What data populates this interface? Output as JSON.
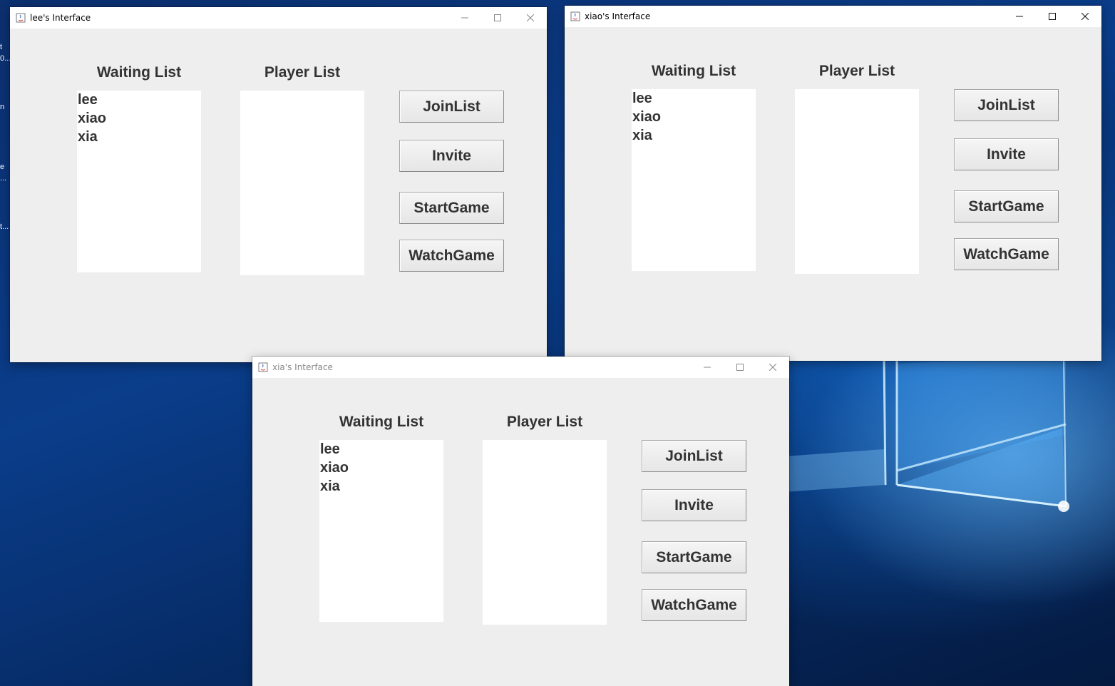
{
  "desktop": {
    "side_labels": [
      "t",
      "0...",
      "n",
      "e",
      "...",
      "t..."
    ]
  },
  "windows": [
    {
      "title": "lee's Interface",
      "waiting_heading": "Waiting List",
      "player_heading": "Player List",
      "waiting": [
        "lee",
        "xiao",
        "xia"
      ],
      "players": [],
      "buttons": {
        "join": "JoinList",
        "invite": "Invite",
        "start": "StartGame",
        "watch": "WatchGame"
      }
    },
    {
      "title": "xiao's Interface",
      "waiting_heading": "Waiting List",
      "player_heading": "Player List",
      "waiting": [
        "lee",
        "xiao",
        "xia"
      ],
      "players": [],
      "buttons": {
        "join": "JoinList",
        "invite": "Invite",
        "start": "StartGame",
        "watch": "WatchGame"
      }
    },
    {
      "title": "xia's Interface",
      "waiting_heading": "Waiting List",
      "player_heading": "Player List",
      "waiting": [
        "lee",
        "xiao",
        "xia"
      ],
      "players": [],
      "buttons": {
        "join": "JoinList",
        "invite": "Invite",
        "start": "StartGame",
        "watch": "WatchGame"
      }
    }
  ],
  "icons": {
    "title": "java-icon",
    "minimize": "minimize-icon",
    "maximize": "maximize-icon",
    "close": "close-icon"
  }
}
